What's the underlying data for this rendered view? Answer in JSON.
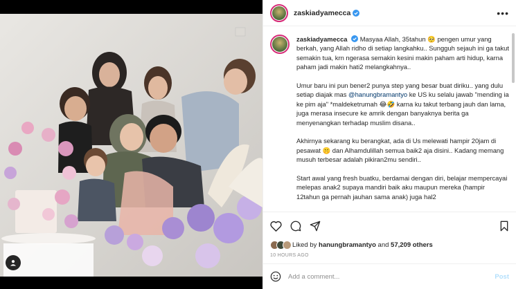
{
  "post": {
    "username": "zaskiadyamecca",
    "verified": true,
    "more_icon": "more-horizontal-icon",
    "caption_paragraphs": [
      "Masyaa Allah, 35tahun 🥺 pengen umur yang berkah, yang Allah ridho di setiap langkahku.. Sungguh sejauh ini ga takut semakin tua, krn ngerasa semakin kesini makin paham arti hidup, karna paham jadi makin hati2 melangkahnya..",
      "Umur baru ini pun bener2 punya step yang besar buat diriku.. yang dulu setiap diajak mas",
      "Akhirnya sekarang ku berangkat, ada di Us melewati hampir 20jam di pesawat 🤫 dan Alhamdulillah semua baik2 aja disini.. Kadang memang musuh terbesar adalah pikiran2mu sendiri..",
      "Start awal yang fresh buatku, berdamai dengan diri, belajar mempercayai melepas anak2 supaya mandiri baik aku maupun mereka (hampir 12tahun ga pernah jauhan sama anak) juga hal2"
    ],
    "mention": "@hanungbramantyo",
    "paragraph2_rest": " ke US ku selalu jawab \"mending ia ke pim aja\" *maldeketrumah 😂🤣 karna ku takut terbang jauh dan lama, juga merasa insecure ke amrik dengan banyaknya berita ga menyenangkan terhadap muslim disana..",
    "likes": {
      "prefix": "Liked by",
      "user": "hanungbramantyo",
      "joiner": "and",
      "others": "57,209 others"
    },
    "timestamp": "10 HOURS AGO",
    "comment_placeholder": "Add a comment...",
    "post_label": "Post"
  },
  "colors": {
    "verified_blue": "#3897f0",
    "link_blue": "#00376b",
    "post_button_disabled": "#b2dffc",
    "muted_gray": "#8e8e8e"
  },
  "icons": [
    "like-icon",
    "comment-icon",
    "share-icon",
    "save-icon",
    "emoji-icon",
    "user-tag-icon",
    "verified-icon"
  ]
}
